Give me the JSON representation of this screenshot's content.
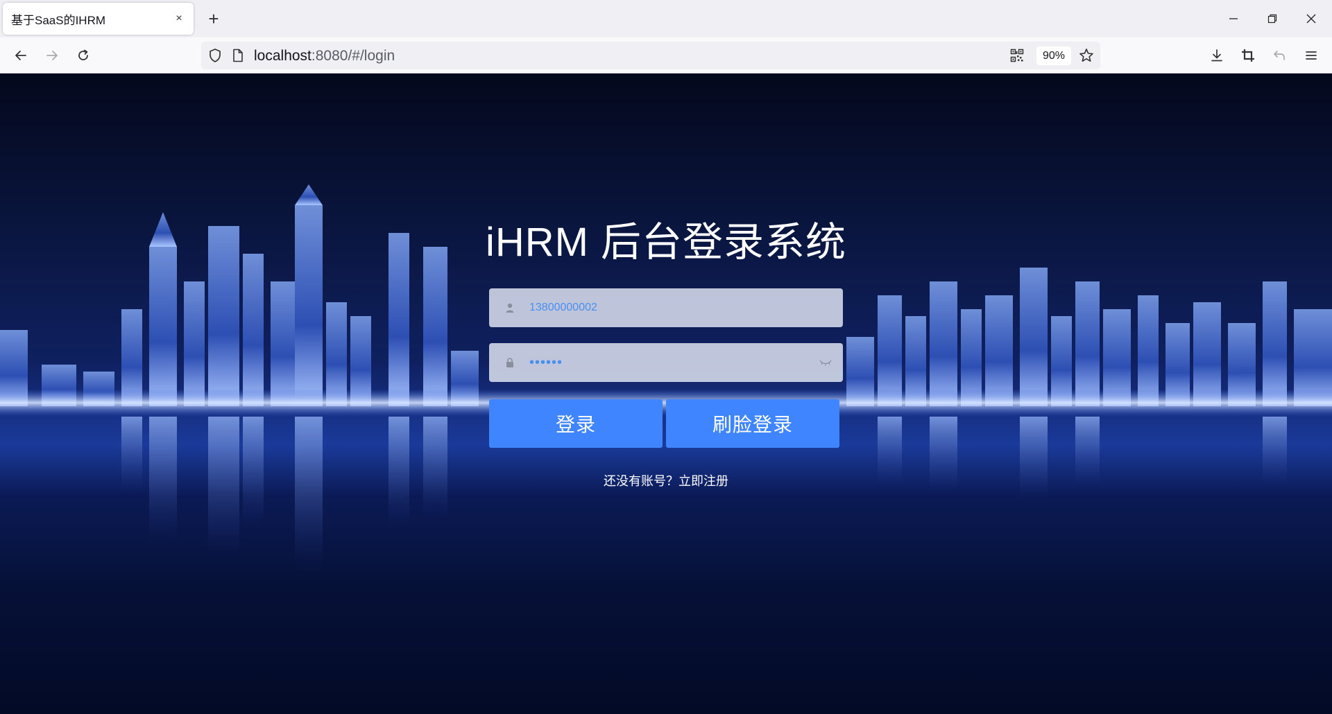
{
  "browser": {
    "tab_title": "基于SaaS的IHRM",
    "tab_close": "×",
    "new_tab": "+",
    "url_host": "localhost",
    "url_rest": ":8080/#/login",
    "zoom": "90%",
    "icons": [
      "back-icon",
      "forward-icon",
      "reload-icon",
      "shield-icon",
      "page-icon",
      "qr-code-icon",
      "star-icon",
      "download-icon",
      "screenshot-icon",
      "undo-icon",
      "menu-icon",
      "minimize-icon",
      "restore-icon",
      "close-icon"
    ]
  },
  "login": {
    "title": "iHRM 后台登录系统",
    "username_value": "13800000002",
    "password_value": "••••••",
    "login_button": "登录",
    "face_login_button": "刷脸登录",
    "register_link": "还没有账号？立即注册"
  },
  "colors": {
    "primary_button": "#3f85ff",
    "input_text": "#4a8ff0"
  }
}
